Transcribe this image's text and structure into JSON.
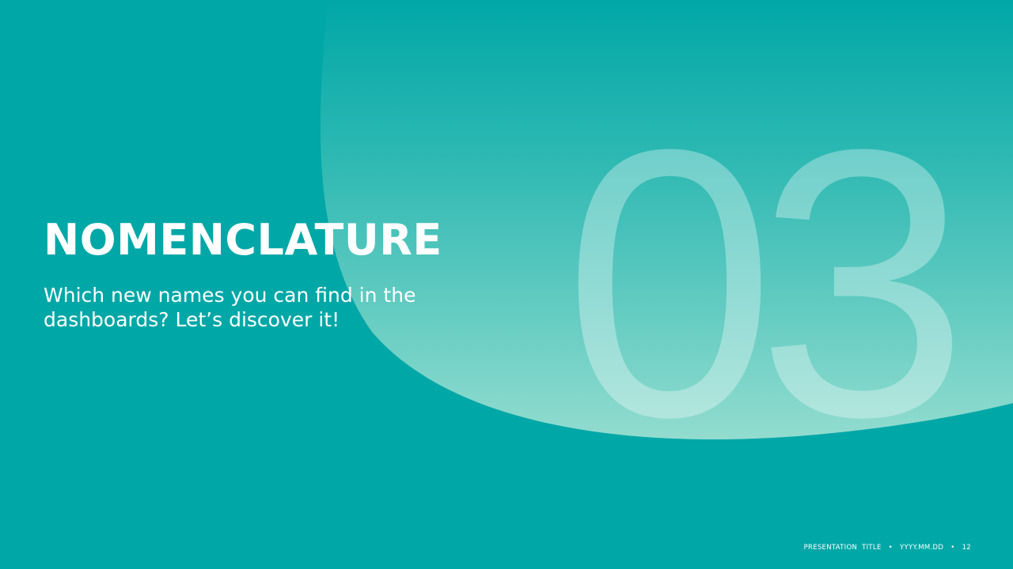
{
  "slide": {
    "section_number": "03",
    "title": "NOMENCLATURE",
    "subtitle": "Which new names you can find in the dashboards? Let’s discover it!",
    "colors": {
      "background": "#00a7a7",
      "shape_top": "#00a7a7",
      "shape_bottom": "#8fdacd",
      "text": "#ffffff"
    }
  },
  "footer": {
    "presentation_title": "PRESENTATION  TITLE",
    "separator": "•",
    "date": "YYYY.MM.DD",
    "page_number": "12"
  }
}
